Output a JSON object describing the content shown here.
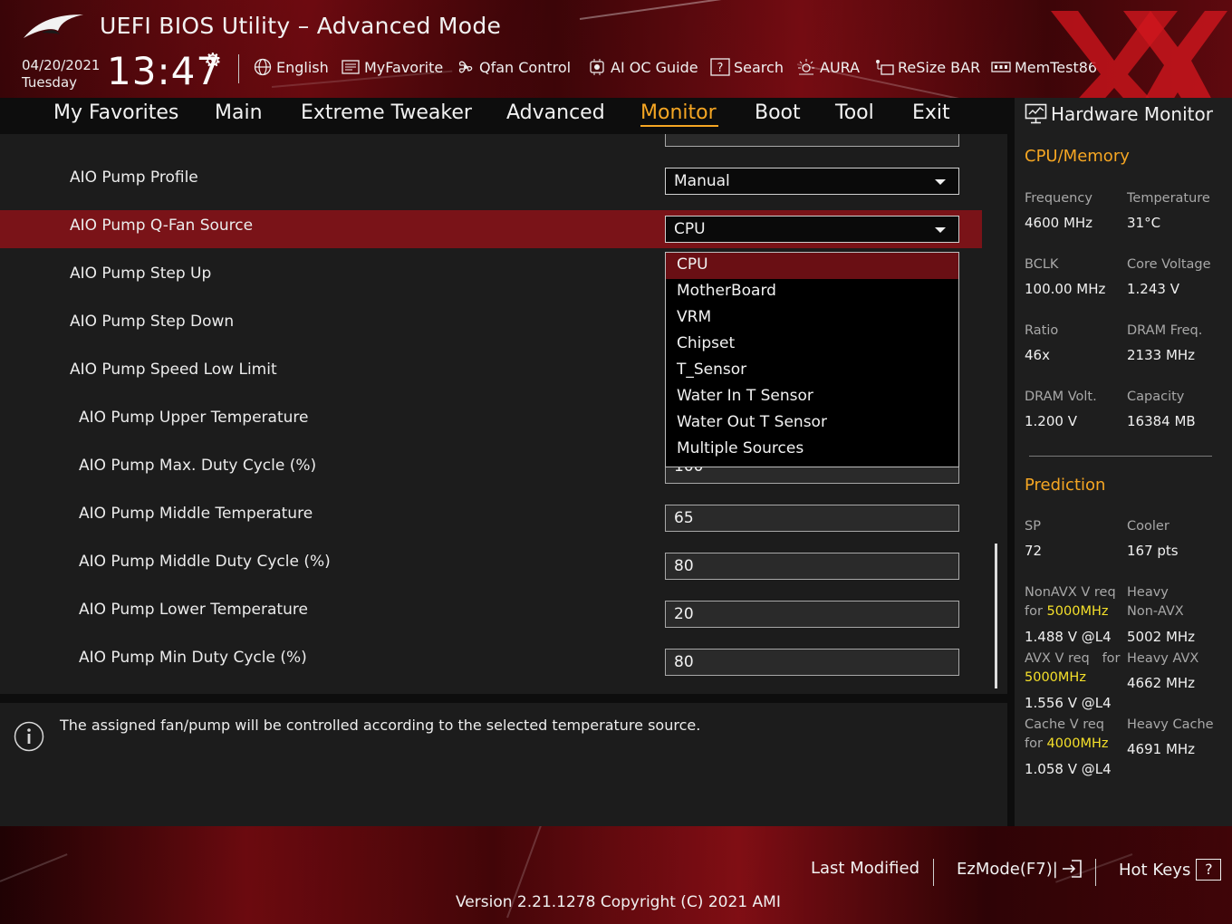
{
  "header": {
    "title": "UEFI BIOS Utility – Advanced Mode",
    "date": "04/20/2021",
    "weekday": "Tuesday",
    "time": "13:47",
    "toolbar": [
      {
        "label": "English",
        "icon": "globe-icon"
      },
      {
        "label": "MyFavorite",
        "icon": "favorite-list-icon"
      },
      {
        "label": "Qfan Control",
        "icon": "fan-icon"
      },
      {
        "label": "AI OC Guide",
        "icon": "ai-chip-icon"
      },
      {
        "label": "Search",
        "icon": "search-help-icon"
      },
      {
        "label": "AURA",
        "icon": "aura-light-icon"
      },
      {
        "label": "ReSize BAR",
        "icon": "resize-bar-icon"
      },
      {
        "label": "MemTest86",
        "icon": "memory-icon"
      }
    ]
  },
  "nav": {
    "tabs": [
      "My Favorites",
      "Main",
      "Extreme Tweaker",
      "Advanced",
      "Monitor",
      "Boot",
      "Tool",
      "Exit"
    ],
    "active": "Monitor"
  },
  "settings": [
    {
      "label": "AIO Pump Profile",
      "value": "Manual",
      "type": "select"
    },
    {
      "label": "AIO Pump Q-Fan Source",
      "value": "CPU",
      "type": "select"
    },
    {
      "label": "AIO Pump Step Up",
      "value": "",
      "type": "select"
    },
    {
      "label": "AIO Pump Step Down",
      "value": "",
      "type": "select"
    },
    {
      "label": "AIO Pump Speed Low Limit",
      "value": "",
      "type": "select"
    },
    {
      "label": "AIO Pump Upper Temperature",
      "value": "",
      "type": "number"
    },
    {
      "label": "AIO Pump Max. Duty Cycle (%)",
      "value": "100",
      "type": "number"
    },
    {
      "label": "AIO Pump Middle Temperature",
      "value": "65",
      "type": "number"
    },
    {
      "label": "AIO Pump Middle Duty Cycle (%)",
      "value": "80",
      "type": "number"
    },
    {
      "label": "AIO Pump Lower Temperature",
      "value": "20",
      "type": "number"
    },
    {
      "label": "AIO Pump Min Duty Cycle (%)",
      "value": "80",
      "type": "number"
    }
  ],
  "dropdown": {
    "options": [
      "CPU",
      "MotherBoard",
      "VRM",
      "Chipset",
      "T_Sensor",
      "Water In T Sensor",
      "Water Out T Sensor",
      "Multiple Sources"
    ],
    "selected": "CPU"
  },
  "info": {
    "text": "The assigned fan/pump will be controlled according to the selected temperature source."
  },
  "hardware_monitor": {
    "title": "Hardware Monitor",
    "cpu_memory": {
      "heading": "CPU/Memory",
      "items": [
        {
          "label": "Frequency",
          "value": "4600 MHz"
        },
        {
          "label": "Temperature",
          "value": "31°C"
        },
        {
          "label": "BCLK",
          "value": "100.00 MHz"
        },
        {
          "label": "Core Voltage",
          "value": "1.243 V"
        },
        {
          "label": "Ratio",
          "value": "46x"
        },
        {
          "label": "DRAM Freq.",
          "value": "2133 MHz"
        },
        {
          "label": "DRAM Volt.",
          "value": "1.200 V"
        },
        {
          "label": "Capacity",
          "value": "16384 MB"
        }
      ]
    },
    "prediction": {
      "heading": "Prediction",
      "sp_label": "SP",
      "sp_value": "72",
      "cooler_label": "Cooler",
      "cooler_value": "167 pts",
      "nonavx_label": "NonAVX V req",
      "nonavx_for": "for",
      "nonavx_freq": "5000MHz",
      "nonavx_value": "1.488 V @L4",
      "heavy_nonavx_label1": "Heavy",
      "heavy_nonavx_label2": "Non-AVX",
      "heavy_nonavx_value": "5002 MHz",
      "avx_label": "AVX V req",
      "avx_for": "for",
      "avx_freq": "5000MHz",
      "avx_value": "1.556 V @L4",
      "heavy_avx_label": "Heavy AVX",
      "heavy_avx_value": "4662 MHz",
      "cache_label": "Cache V req",
      "cache_for": "for",
      "cache_freq": "4000MHz",
      "cache_value": "1.058 V @L4",
      "heavy_cache_label": "Heavy Cache",
      "heavy_cache_value": "4691 MHz"
    }
  },
  "footer": {
    "last_modified": "Last Modified",
    "ezmode": "EzMode(F7)|",
    "hotkeys": "Hot Keys",
    "hotkeys_key": "?",
    "version": "Version 2.21.1278 Copyright (C) 2021 AMI"
  },
  "colors": {
    "accent": "#f5a623",
    "highlight_row": "#7a1318",
    "brand_red": "#8a0d14",
    "frequency_yellow": "#f5e02a"
  }
}
